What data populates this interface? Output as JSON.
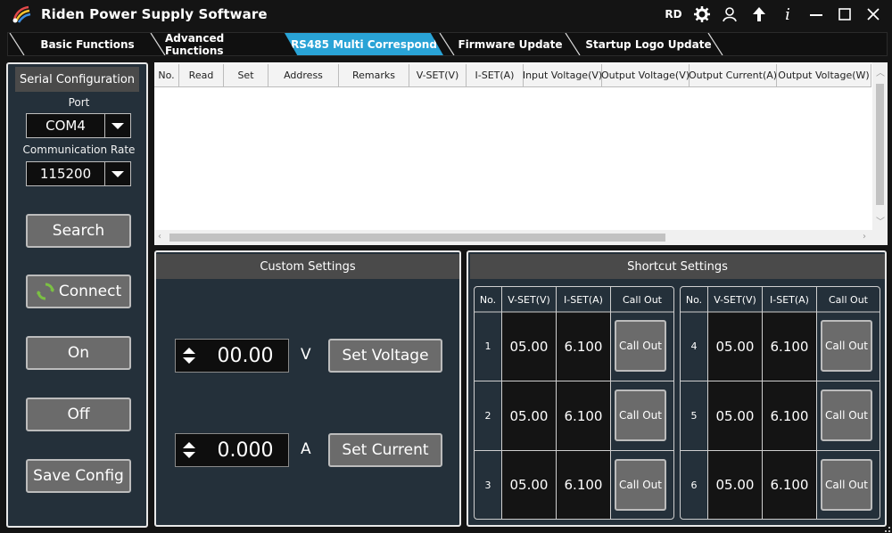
{
  "window": {
    "title": "Riden Power Supply Software",
    "rd_label": "RD",
    "icons": [
      "rd-logo",
      "gear-icon",
      "user-icon",
      "upload-arrow-icon",
      "info-icon",
      "minimize-icon",
      "maximize-icon",
      "close-icon"
    ]
  },
  "tabs": [
    {
      "label": "Basic Functions",
      "active": false
    },
    {
      "label": "Advanced Functions",
      "active": false
    },
    {
      "label": "RS485 Multi Correspond",
      "active": true
    },
    {
      "label": "Firmware Update",
      "active": false
    },
    {
      "label": "Startup Logo Update",
      "active": false
    }
  ],
  "serial": {
    "header": "Serial Configuration",
    "port_label": "Port",
    "port_value": "COM4",
    "rate_label": "Communication Rate",
    "rate_value": "115200",
    "search_label": "Search",
    "connect_label": "Connect",
    "on_label": "On",
    "off_label": "Off",
    "save_label": "Save Config"
  },
  "table": {
    "columns": [
      "No.",
      "Read",
      "Set",
      "Address",
      "Remarks",
      "V-SET(V)",
      "I-SET(A)",
      "Input Voltage(V)",
      "Output Voltage(V)",
      "Output Current(A)",
      "Output Voltage(W)"
    ],
    "rows": []
  },
  "custom": {
    "header": "Custom Settings",
    "voltage_value": "00.00",
    "voltage_unit": "V",
    "set_voltage_label": "Set Voltage",
    "current_value": "0.000",
    "current_unit": "A",
    "set_current_label": "Set Current"
  },
  "shortcut": {
    "header": "Shortcut Settings",
    "columns": [
      "No.",
      "V-SET(V)",
      "I-SET(A)",
      "Call Out"
    ],
    "left": [
      {
        "no": "1",
        "v": "05.00",
        "i": "6.100",
        "call": "Call Out"
      },
      {
        "no": "2",
        "v": "05.00",
        "i": "6.100",
        "call": "Call Out"
      },
      {
        "no": "3",
        "v": "05.00",
        "i": "6.100",
        "call": "Call Out"
      }
    ],
    "right": [
      {
        "no": "4",
        "v": "05.00",
        "i": "6.100",
        "call": "Call Out"
      },
      {
        "no": "5",
        "v": "05.00",
        "i": "6.100",
        "call": "Call Out"
      },
      {
        "no": "6",
        "v": "05.00",
        "i": "6.100",
        "call": "Call Out"
      }
    ]
  },
  "colors": {
    "accent": "#29a3d6",
    "panel": "#24303a",
    "button": "#6b6b6b",
    "connect_icon": "#7bc043"
  }
}
